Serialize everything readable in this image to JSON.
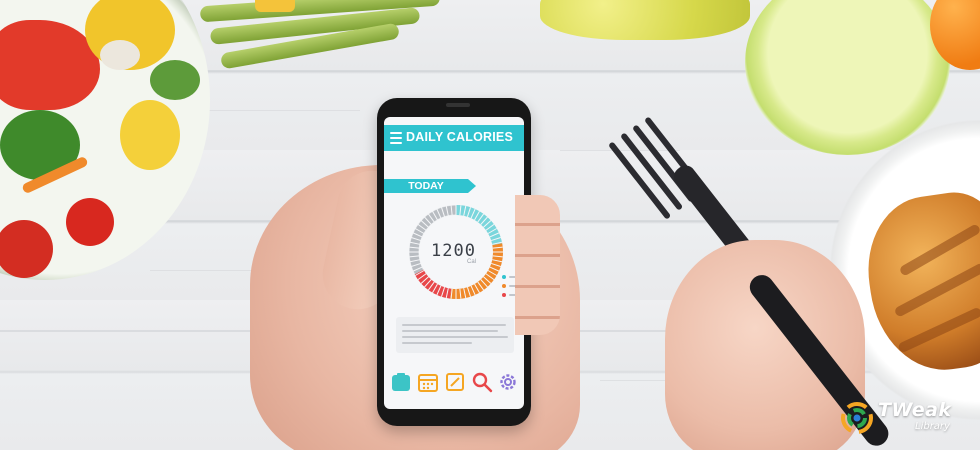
{
  "app": {
    "title": "DAILY CALORIES",
    "today_label": "TODAY",
    "calories_value": "1200",
    "calories_unit": "Cal",
    "gauge": {
      "segments": [
        {
          "color": "#7ad6dc",
          "fraction": 0.22
        },
        {
          "color": "#f08a2b",
          "fraction": 0.3
        },
        {
          "color": "#e8474a",
          "fraction": 0.15
        },
        {
          "color": "#b9bdc2",
          "fraction": 0.33
        }
      ]
    },
    "legend_colors": [
      "#2fc3cf",
      "#f08a2b",
      "#e8474a"
    ],
    "toolbar_icons": [
      {
        "name": "scale-icon",
        "color": "#3cc4c6"
      },
      {
        "name": "calendar-icon",
        "color": "#f5a623"
      },
      {
        "name": "notes-icon",
        "color": "#f5a623"
      },
      {
        "name": "search-icon",
        "color": "#e8474a"
      },
      {
        "name": "settings-gear-icon",
        "color": "#8b77d8"
      }
    ]
  },
  "logo": {
    "word": "TWeak",
    "sub": "Library"
  },
  "colors": {
    "accent": "#2fc3cf",
    "table": "#e9eaec"
  }
}
